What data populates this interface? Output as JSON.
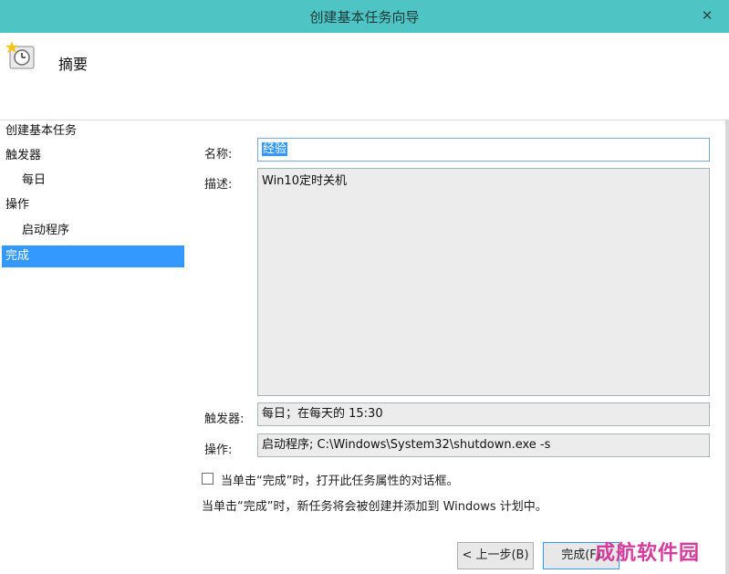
{
  "window": {
    "title": "创建基本任务向导",
    "close_glyph": "✕"
  },
  "header": {
    "heading": "摘要",
    "icon": "task-scheduler-clock-icon"
  },
  "sidebar": {
    "items": [
      {
        "label": "创建基本任务"
      },
      {
        "label": "触发器"
      },
      {
        "label": "每日"
      },
      {
        "label": "操作"
      },
      {
        "label": "启动程序"
      },
      {
        "label": "完成"
      }
    ]
  },
  "form": {
    "name_label": "名称:",
    "name_value": "经验",
    "description_label": "描述:",
    "description_value": "Win10定时关机",
    "trigger_label": "触发器:",
    "trigger_value": "每日；在每天的 15:30",
    "action_label": "操作:",
    "action_value": "启动程序; C:\\Windows\\System32\\shutdown.exe -s"
  },
  "options": {
    "open_properties_label": "当单击“完成”时，打开此任务属性的对话框。",
    "open_properties_checked": false,
    "info_text": "当单击“完成”时，新任务将会被创建并添加到 Windows 计划中。"
  },
  "buttons": {
    "back_label": "< 上一步(B)",
    "finish_label": "完成(F)"
  },
  "watermark": "成航软件园",
  "colors": {
    "titlebar": "#4fc4c4",
    "selection": "#3399ff",
    "watermark": "#d43c9d"
  }
}
